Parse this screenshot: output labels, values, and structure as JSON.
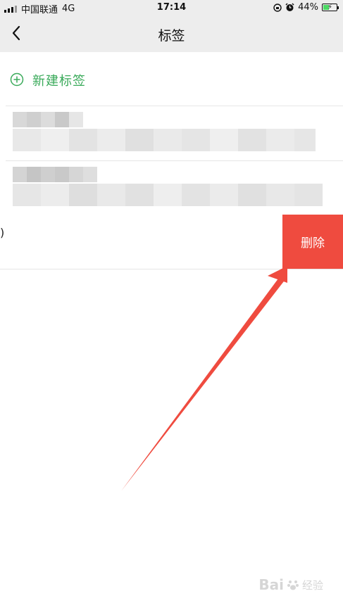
{
  "status_bar": {
    "carrier": "中国联通",
    "network": "4G",
    "time": "17:14",
    "battery_percent": "44%",
    "battery_level": 0.44
  },
  "nav": {
    "title": "标签"
  },
  "new_tag": {
    "label": "新建标签"
  },
  "swiped_row": {
    "visible_text": ")",
    "delete_label": "删除"
  },
  "watermark": {
    "logo": "Bai",
    "text": "经验"
  },
  "colors": {
    "accent_green": "#3aaa5a",
    "delete_red": "#ef4b3f",
    "annotation_arrow": "#ef4b3f",
    "nav_background": "#ededed"
  },
  "icons": {
    "back": "chevron-left-icon",
    "new_tag": "plus-circle-icon",
    "alarm": "alarm-clock-icon",
    "lock": "orientation-lock-icon"
  }
}
